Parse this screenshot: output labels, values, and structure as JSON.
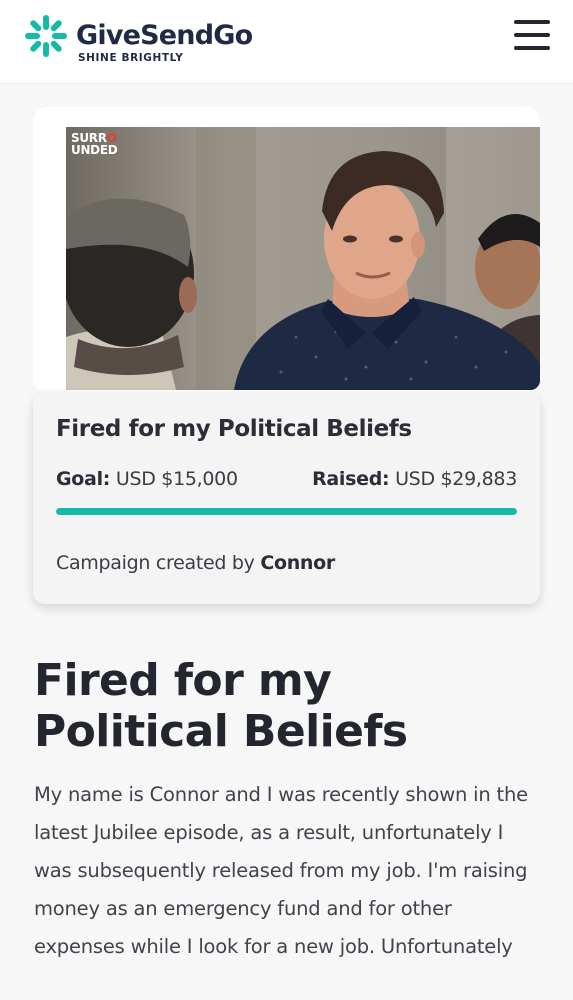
{
  "header": {
    "brand_name": "GiveSendGo",
    "brand_tagline": "SHINE BRIGHTLY",
    "menu_icon": "hamburger-menu-icon"
  },
  "colors": {
    "brand_teal": "#16b8a8",
    "brand_navy": "#1f2a44",
    "watermark_red": "#e63b33"
  },
  "hero": {
    "watermark_line1": "SURR",
    "watermark_line1_accent": "O",
    "watermark_line2": "UNDED"
  },
  "campaign": {
    "title": "Fired for my Political Beliefs",
    "goal_label": "Goal:",
    "goal_value": "USD $15,000",
    "raised_label": "Raised:",
    "raised_value": "USD $29,883",
    "progress_percent": 100,
    "created_by_label": "Campaign created by",
    "creator_name": "Connor"
  },
  "story": {
    "heading": "Fired for my Political Beliefs",
    "body": "My name is Connor and I was recently shown in the latest Jubilee episode, as a result, unfortunately I was subsequently released from my job. I'm raising money as an emergency fund and for other expenses while I look for a new job. Unfortunately"
  }
}
